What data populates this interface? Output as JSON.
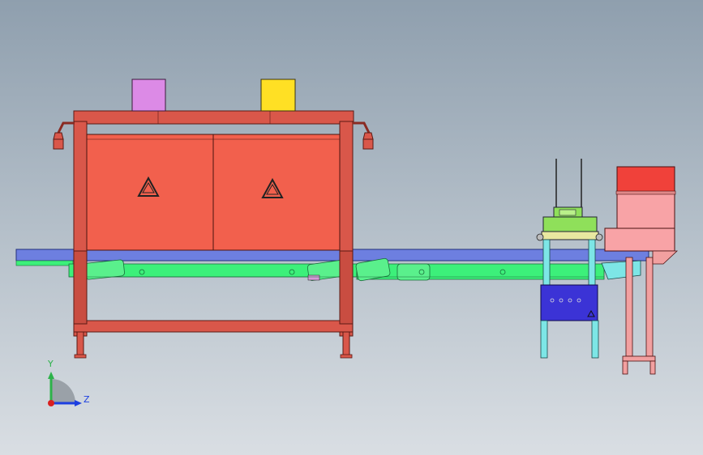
{
  "viewport": {
    "background_top": "#8f9fae",
    "background_bottom": "#d9dee3"
  },
  "triad": {
    "y_label": "Y",
    "z_label": "Z",
    "y_color": "#2db24a",
    "z_color": "#1c3fe0",
    "origin_color": "#d92020"
  },
  "colors": {
    "frame": "#d9574a",
    "frame_dark": "#b8433a",
    "door": "#f2604d",
    "conveyor": "#6d7fe0",
    "chain": "#3cf07a",
    "chain_dark": "#2ab15a",
    "box_magenta": "#dc8ae6",
    "box_yellow": "#ffe024",
    "cabinet_blue": "#3b33d6",
    "stand_cyan": "#7de6e6",
    "feeder_green": "#8fe05a",
    "unit_red": "#f0413a",
    "unit_pink": "#f8a3a6",
    "stand_pink": "#f2a0a0"
  },
  "icons": {
    "door_left_symbol": "warning-triangle-icon",
    "door_right_symbol": "warning-triangle-icon",
    "cabinet_symbol": "warning-triangle-icon"
  }
}
